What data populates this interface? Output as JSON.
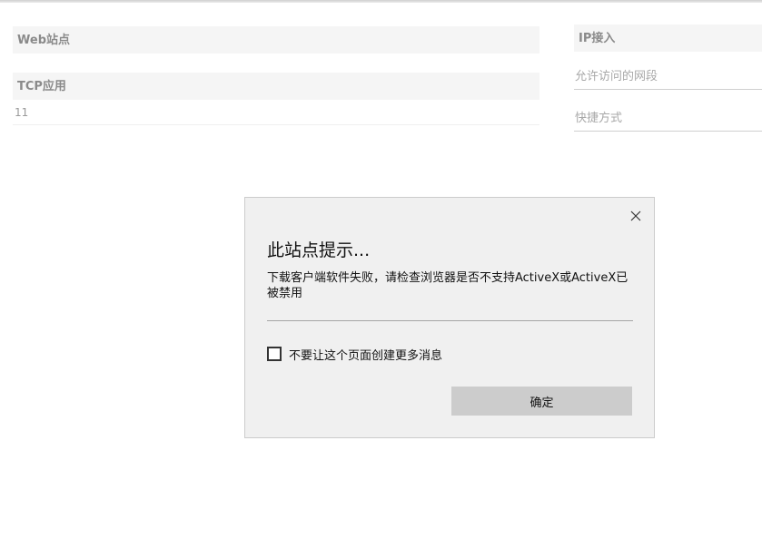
{
  "sections": {
    "web": {
      "title": "Web站点"
    },
    "tcp": {
      "title": "TCP应用",
      "items": [
        "11"
      ]
    }
  },
  "ip_access": {
    "title": "IP接入",
    "allowed_range_placeholder": "允许访问的网段",
    "shortcut_placeholder": "快捷方式"
  },
  "dialog": {
    "title": "此站点提示...",
    "message": "下载客户端软件失败，请检查浏览器是否不支持ActiveX或ActiveX已被禁用",
    "checkbox_label": "不要让这个页面创建更多消息",
    "checkbox_checked": false,
    "ok_label": "确定",
    "close_icon": "close-icon"
  }
}
